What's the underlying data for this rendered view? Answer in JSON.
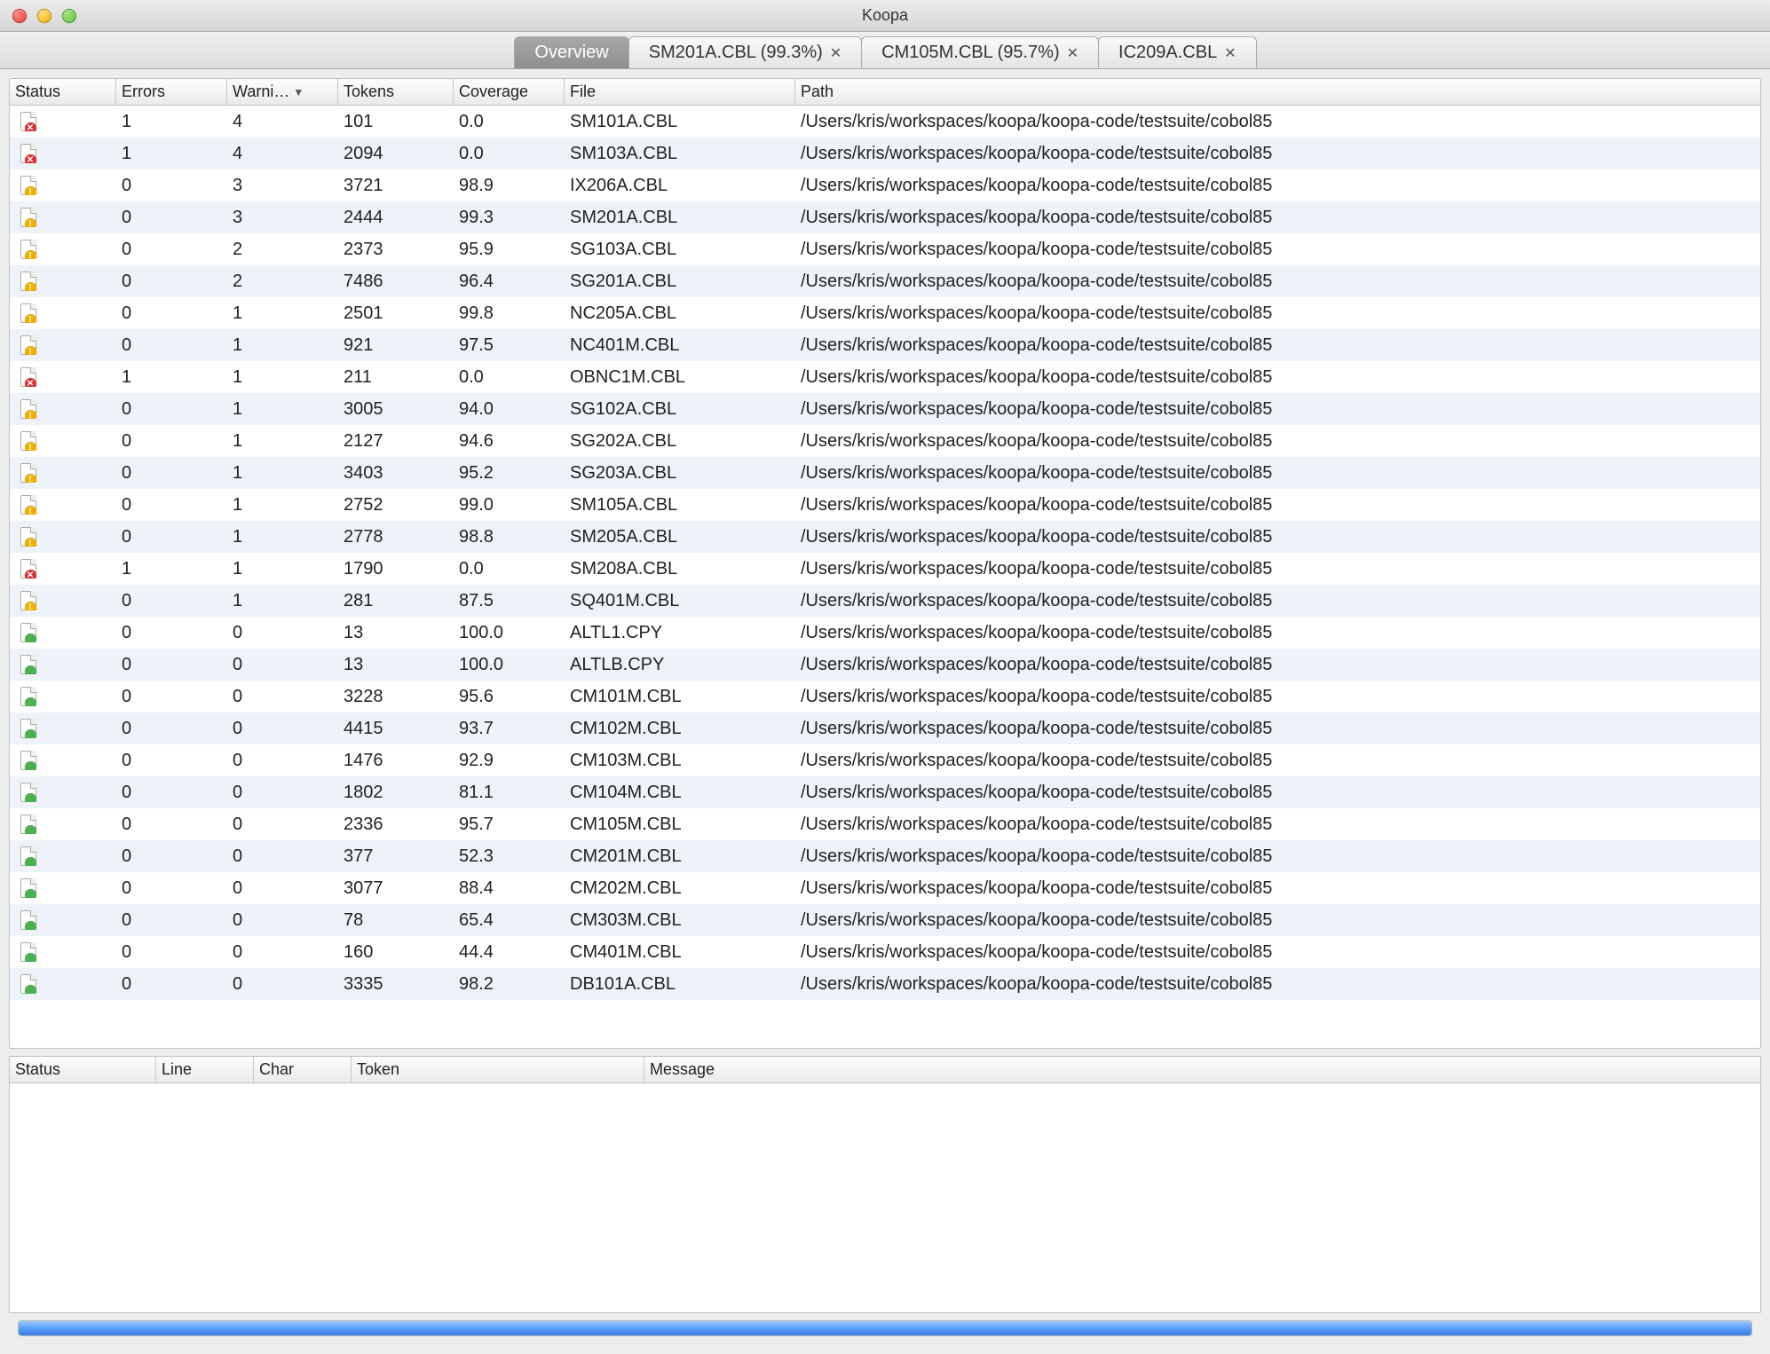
{
  "window": {
    "title": "Koopa"
  },
  "tabs": [
    {
      "label": "Overview",
      "closable": false,
      "active": true
    },
    {
      "label": "SM201A.CBL (99.3%)",
      "closable": true,
      "active": false
    },
    {
      "label": "CM105M.CBL (95.7%)",
      "closable": true,
      "active": false
    },
    {
      "label": "IC209A.CBL",
      "closable": true,
      "active": false
    }
  ],
  "table": {
    "columns": [
      "Status",
      "Errors",
      "Warni…",
      "Tokens",
      "Coverage",
      "File",
      "Path"
    ],
    "sort_column": 2,
    "sort_dir": "desc",
    "rows": [
      {
        "status": "error",
        "errors": 1,
        "warnings": 4,
        "tokens": 101,
        "coverage": "0.0",
        "file": "SM101A.CBL",
        "path": "/Users/kris/workspaces/koopa/koopa-code/testsuite/cobol85"
      },
      {
        "status": "error",
        "errors": 1,
        "warnings": 4,
        "tokens": 2094,
        "coverage": "0.0",
        "file": "SM103A.CBL",
        "path": "/Users/kris/workspaces/koopa/koopa-code/testsuite/cobol85"
      },
      {
        "status": "warn",
        "errors": 0,
        "warnings": 3,
        "tokens": 3721,
        "coverage": "98.9",
        "file": "IX206A.CBL",
        "path": "/Users/kris/workspaces/koopa/koopa-code/testsuite/cobol85"
      },
      {
        "status": "warn",
        "errors": 0,
        "warnings": 3,
        "tokens": 2444,
        "coverage": "99.3",
        "file": "SM201A.CBL",
        "path": "/Users/kris/workspaces/koopa/koopa-code/testsuite/cobol85"
      },
      {
        "status": "warn",
        "errors": 0,
        "warnings": 2,
        "tokens": 2373,
        "coverage": "95.9",
        "file": "SG103A.CBL",
        "path": "/Users/kris/workspaces/koopa/koopa-code/testsuite/cobol85"
      },
      {
        "status": "warn",
        "errors": 0,
        "warnings": 2,
        "tokens": 7486,
        "coverage": "96.4",
        "file": "SG201A.CBL",
        "path": "/Users/kris/workspaces/koopa/koopa-code/testsuite/cobol85"
      },
      {
        "status": "warn",
        "errors": 0,
        "warnings": 1,
        "tokens": 2501,
        "coverage": "99.8",
        "file": "NC205A.CBL",
        "path": "/Users/kris/workspaces/koopa/koopa-code/testsuite/cobol85"
      },
      {
        "status": "warn",
        "errors": 0,
        "warnings": 1,
        "tokens": 921,
        "coverage": "97.5",
        "file": "NC401M.CBL",
        "path": "/Users/kris/workspaces/koopa/koopa-code/testsuite/cobol85"
      },
      {
        "status": "error",
        "errors": 1,
        "warnings": 1,
        "tokens": 211,
        "coverage": "0.0",
        "file": "OBNC1M.CBL",
        "path": "/Users/kris/workspaces/koopa/koopa-code/testsuite/cobol85"
      },
      {
        "status": "warn",
        "errors": 0,
        "warnings": 1,
        "tokens": 3005,
        "coverage": "94.0",
        "file": "SG102A.CBL",
        "path": "/Users/kris/workspaces/koopa/koopa-code/testsuite/cobol85"
      },
      {
        "status": "warn",
        "errors": 0,
        "warnings": 1,
        "tokens": 2127,
        "coverage": "94.6",
        "file": "SG202A.CBL",
        "path": "/Users/kris/workspaces/koopa/koopa-code/testsuite/cobol85"
      },
      {
        "status": "warn",
        "errors": 0,
        "warnings": 1,
        "tokens": 3403,
        "coverage": "95.2",
        "file": "SG203A.CBL",
        "path": "/Users/kris/workspaces/koopa/koopa-code/testsuite/cobol85"
      },
      {
        "status": "warn",
        "errors": 0,
        "warnings": 1,
        "tokens": 2752,
        "coverage": "99.0",
        "file": "SM105A.CBL",
        "path": "/Users/kris/workspaces/koopa/koopa-code/testsuite/cobol85"
      },
      {
        "status": "warn",
        "errors": 0,
        "warnings": 1,
        "tokens": 2778,
        "coverage": "98.8",
        "file": "SM205A.CBL",
        "path": "/Users/kris/workspaces/koopa/koopa-code/testsuite/cobol85"
      },
      {
        "status": "error",
        "errors": 1,
        "warnings": 1,
        "tokens": 1790,
        "coverage": "0.0",
        "file": "SM208A.CBL",
        "path": "/Users/kris/workspaces/koopa/koopa-code/testsuite/cobol85"
      },
      {
        "status": "warn",
        "errors": 0,
        "warnings": 1,
        "tokens": 281,
        "coverage": "87.5",
        "file": "SQ401M.CBL",
        "path": "/Users/kris/workspaces/koopa/koopa-code/testsuite/cobol85"
      },
      {
        "status": "ok",
        "errors": 0,
        "warnings": 0,
        "tokens": 13,
        "coverage": "100.0",
        "file": "ALTL1.CPY",
        "path": "/Users/kris/workspaces/koopa/koopa-code/testsuite/cobol85"
      },
      {
        "status": "ok",
        "errors": 0,
        "warnings": 0,
        "tokens": 13,
        "coverage": "100.0",
        "file": "ALTLB.CPY",
        "path": "/Users/kris/workspaces/koopa/koopa-code/testsuite/cobol85"
      },
      {
        "status": "ok",
        "errors": 0,
        "warnings": 0,
        "tokens": 3228,
        "coverage": "95.6",
        "file": "CM101M.CBL",
        "path": "/Users/kris/workspaces/koopa/koopa-code/testsuite/cobol85"
      },
      {
        "status": "ok",
        "errors": 0,
        "warnings": 0,
        "tokens": 4415,
        "coverage": "93.7",
        "file": "CM102M.CBL",
        "path": "/Users/kris/workspaces/koopa/koopa-code/testsuite/cobol85"
      },
      {
        "status": "ok",
        "errors": 0,
        "warnings": 0,
        "tokens": 1476,
        "coverage": "92.9",
        "file": "CM103M.CBL",
        "path": "/Users/kris/workspaces/koopa/koopa-code/testsuite/cobol85"
      },
      {
        "status": "ok",
        "errors": 0,
        "warnings": 0,
        "tokens": 1802,
        "coverage": "81.1",
        "file": "CM104M.CBL",
        "path": "/Users/kris/workspaces/koopa/koopa-code/testsuite/cobol85"
      },
      {
        "status": "ok",
        "errors": 0,
        "warnings": 0,
        "tokens": 2336,
        "coverage": "95.7",
        "file": "CM105M.CBL",
        "path": "/Users/kris/workspaces/koopa/koopa-code/testsuite/cobol85"
      },
      {
        "status": "ok",
        "errors": 0,
        "warnings": 0,
        "tokens": 377,
        "coverage": "52.3",
        "file": "CM201M.CBL",
        "path": "/Users/kris/workspaces/koopa/koopa-code/testsuite/cobol85"
      },
      {
        "status": "ok",
        "errors": 0,
        "warnings": 0,
        "tokens": 3077,
        "coverage": "88.4",
        "file": "CM202M.CBL",
        "path": "/Users/kris/workspaces/koopa/koopa-code/testsuite/cobol85"
      },
      {
        "status": "ok",
        "errors": 0,
        "warnings": 0,
        "tokens": 78,
        "coverage": "65.4",
        "file": "CM303M.CBL",
        "path": "/Users/kris/workspaces/koopa/koopa-code/testsuite/cobol85"
      },
      {
        "status": "ok",
        "errors": 0,
        "warnings": 0,
        "tokens": 160,
        "coverage": "44.4",
        "file": "CM401M.CBL",
        "path": "/Users/kris/workspaces/koopa/koopa-code/testsuite/cobol85"
      },
      {
        "status": "ok",
        "errors": 0,
        "warnings": 0,
        "tokens": 3335,
        "coverage": "98.2",
        "file": "DB101A.CBL",
        "path": "/Users/kris/workspaces/koopa/koopa-code/testsuite/cobol85"
      }
    ]
  },
  "details": {
    "columns": [
      "Status",
      "Line",
      "Char",
      "Token",
      "Message"
    ]
  },
  "progress": {
    "percent": 100
  }
}
